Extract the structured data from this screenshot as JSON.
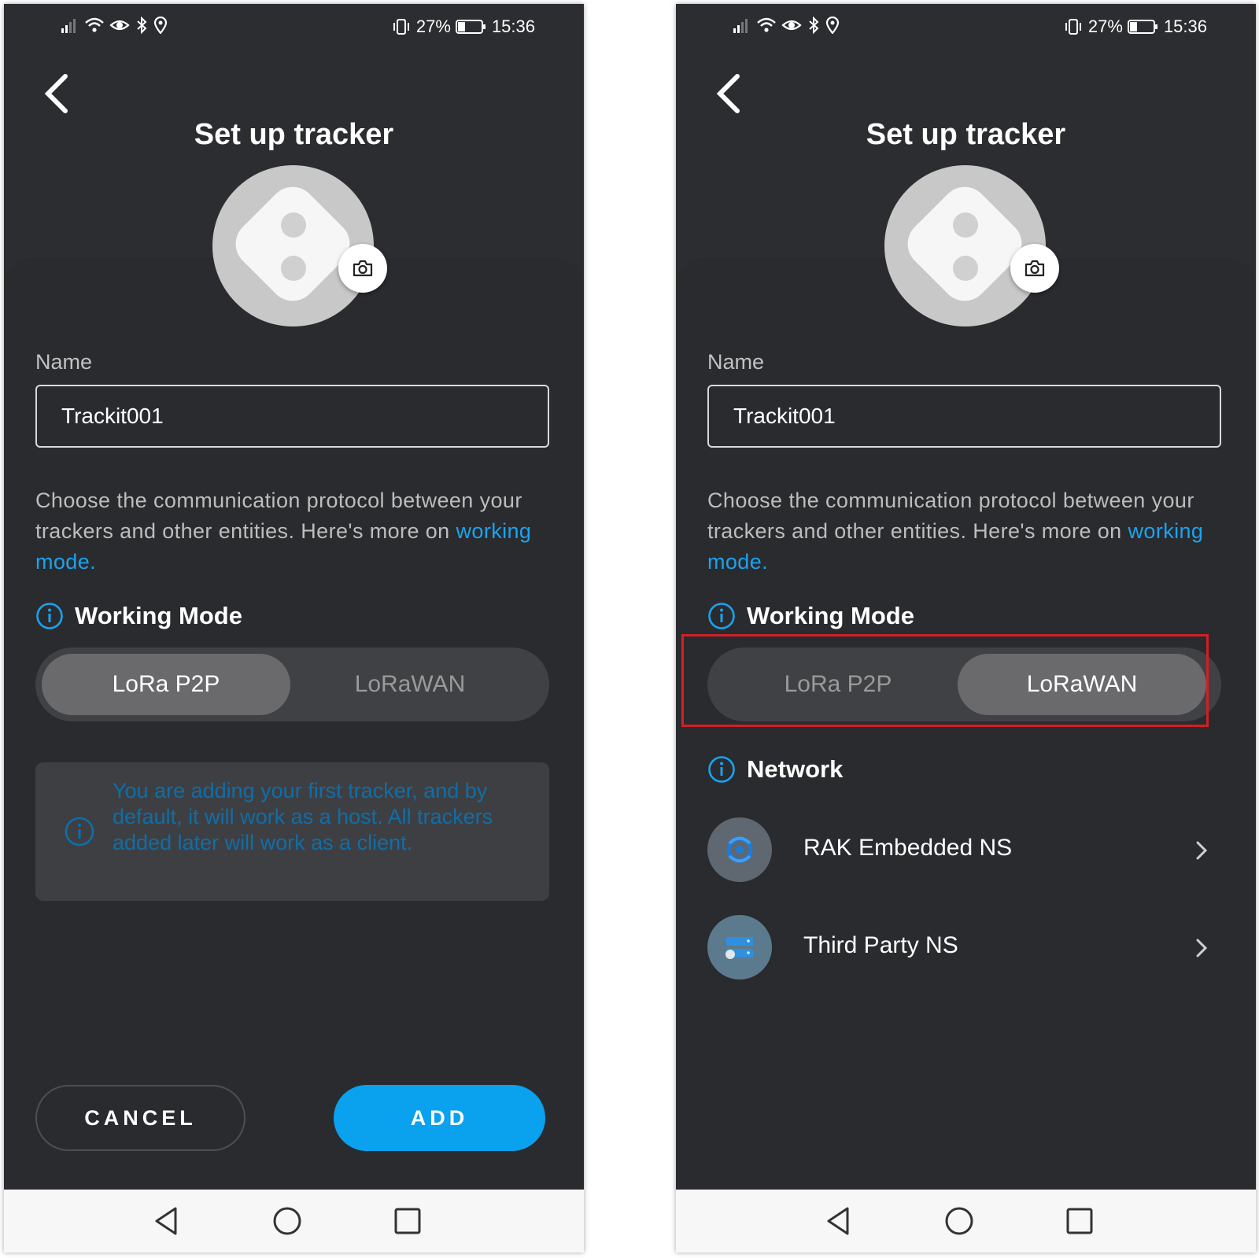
{
  "status_bar": {
    "battery": "27%",
    "time": "15:36"
  },
  "screens": [
    {
      "title": "Set up tracker",
      "name_label": "Name",
      "name_value": "Trackit001",
      "description": "Choose the communication protocol between your trackers and other entities. Here's more on ",
      "description_link": "working mode.",
      "working_mode_heading": "Working Mode",
      "modes": [
        "LoRa P2P",
        "LoRaWAN"
      ],
      "selected_mode": "LoRa P2P",
      "notice": "You are adding your first tracker, and by default, it will work as a host. All trackers added later will work as a client.",
      "cancel_label": "CANCEL",
      "add_label": "ADD"
    },
    {
      "title": "Set up tracker",
      "name_label": "Name",
      "name_value": "Trackit001",
      "description": "Choose the communication protocol between your trackers and other entities. Here's more on ",
      "description_link": "working mode.",
      "working_mode_heading": "Working Mode",
      "modes": [
        "LoRa P2P",
        "LoRaWAN"
      ],
      "selected_mode": "LoRaWAN",
      "network_heading": "Network",
      "network_options": [
        {
          "label": "RAK Embedded NS",
          "icon": "rak-logo-icon"
        },
        {
          "label": "Third Party NS",
          "icon": "server-icon"
        }
      ]
    }
  ],
  "colors": {
    "background": "#2c2d30",
    "accent": "#0aa1ee",
    "link": "#1aa3f0",
    "highlight": "#d21f26"
  }
}
